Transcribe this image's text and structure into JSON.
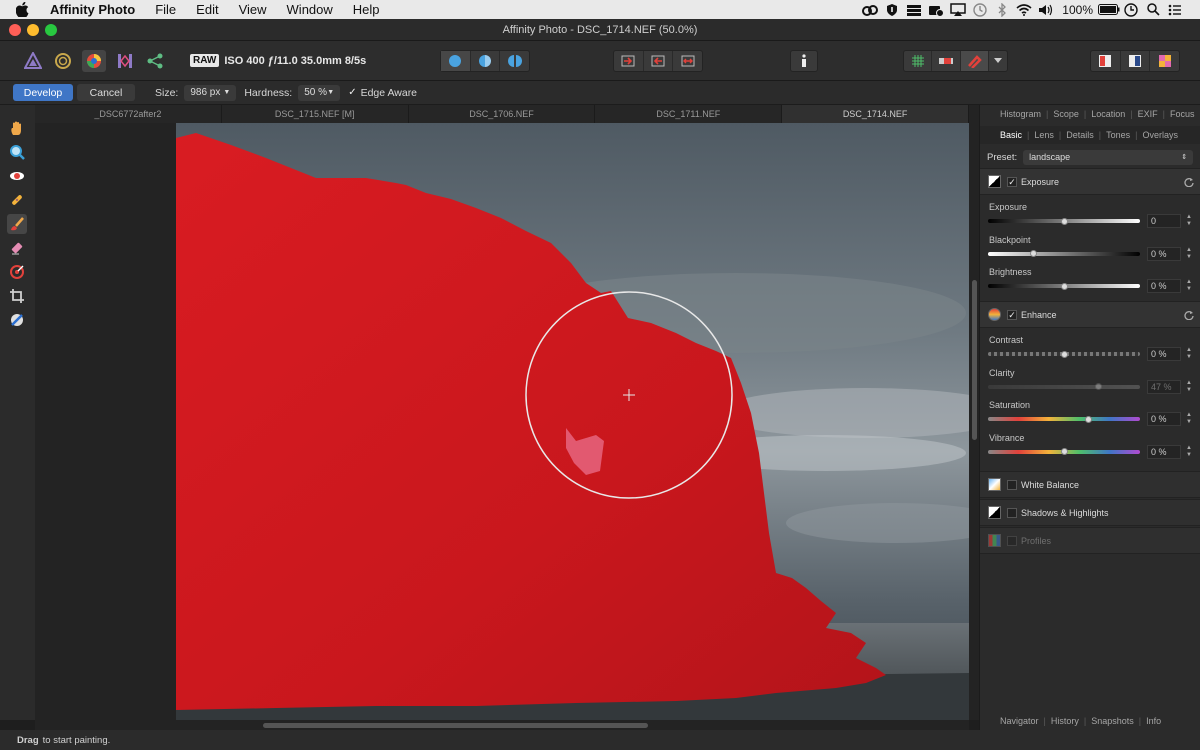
{
  "menubar": {
    "app_name": "Affinity Photo",
    "items": [
      "File",
      "Edit",
      "View",
      "Window",
      "Help"
    ],
    "battery": "100%"
  },
  "window": {
    "title": "Affinity Photo - DSC_1714.NEF (50.0%)"
  },
  "toolbar": {
    "raw_badge": "RAW",
    "exif": "ISO 400 ƒ/11.0 35.0mm 8/5s"
  },
  "context": {
    "develop_label": "Develop",
    "cancel_label": "Cancel",
    "size_label": "Size:",
    "size_value": "986 px",
    "hardness_label": "Hardness:",
    "hardness_value": "50 %",
    "edge_aware_label": "Edge Aware",
    "edge_aware_checked": true
  },
  "doc_tabs": [
    "_DSC6772after2",
    "DSC_1715.NEF [M]",
    "DSC_1706.NEF",
    "DSC_1711.NEF",
    "DSC_1714.NEF"
  ],
  "active_tab": 4,
  "right_panel": {
    "top_tabs": [
      "Histogram",
      "Scope",
      "Location",
      "EXIF",
      "Focus"
    ],
    "sub_tabs": [
      "Basic",
      "Lens",
      "Details",
      "Tones",
      "Overlays"
    ],
    "active_sub_tab": "Basic",
    "preset_label": "Preset:",
    "preset_value": "landscape",
    "exposure_section": {
      "label": "Exposure",
      "checked": true,
      "sliders": [
        {
          "label": "Exposure",
          "value": "0",
          "level": 0.5
        },
        {
          "label": "Blackpoint",
          "value": "0 %",
          "level": 0.3
        },
        {
          "label": "Brightness",
          "value": "0 %",
          "level": 0.5
        }
      ]
    },
    "enhance_section": {
      "label": "Enhance",
      "checked": true,
      "sliders": [
        {
          "label": "Contrast",
          "value": "0 %",
          "level": 0.5
        },
        {
          "label": "Clarity",
          "value": "47 %",
          "level": 0.73,
          "disabled": true
        },
        {
          "label": "Saturation",
          "value": "0 %",
          "level": 0.66
        },
        {
          "label": "Vibrance",
          "value": "0 %",
          "level": 0.5
        }
      ]
    },
    "sections": [
      {
        "label": "White Balance",
        "checked": false
      },
      {
        "label": "Shadows & Highlights",
        "checked": false
      },
      {
        "label": "Profiles",
        "checked": false,
        "disabled": true
      }
    ],
    "bottom_tabs": [
      "Navigator",
      "History",
      "Snapshots",
      "Info"
    ]
  },
  "status": {
    "bold": "Drag",
    "text": "to start painting."
  },
  "colors": {
    "mask_red": "#d6181f",
    "accent_blue": "#3f76c6",
    "panel_bg": "#2b2b2b"
  }
}
